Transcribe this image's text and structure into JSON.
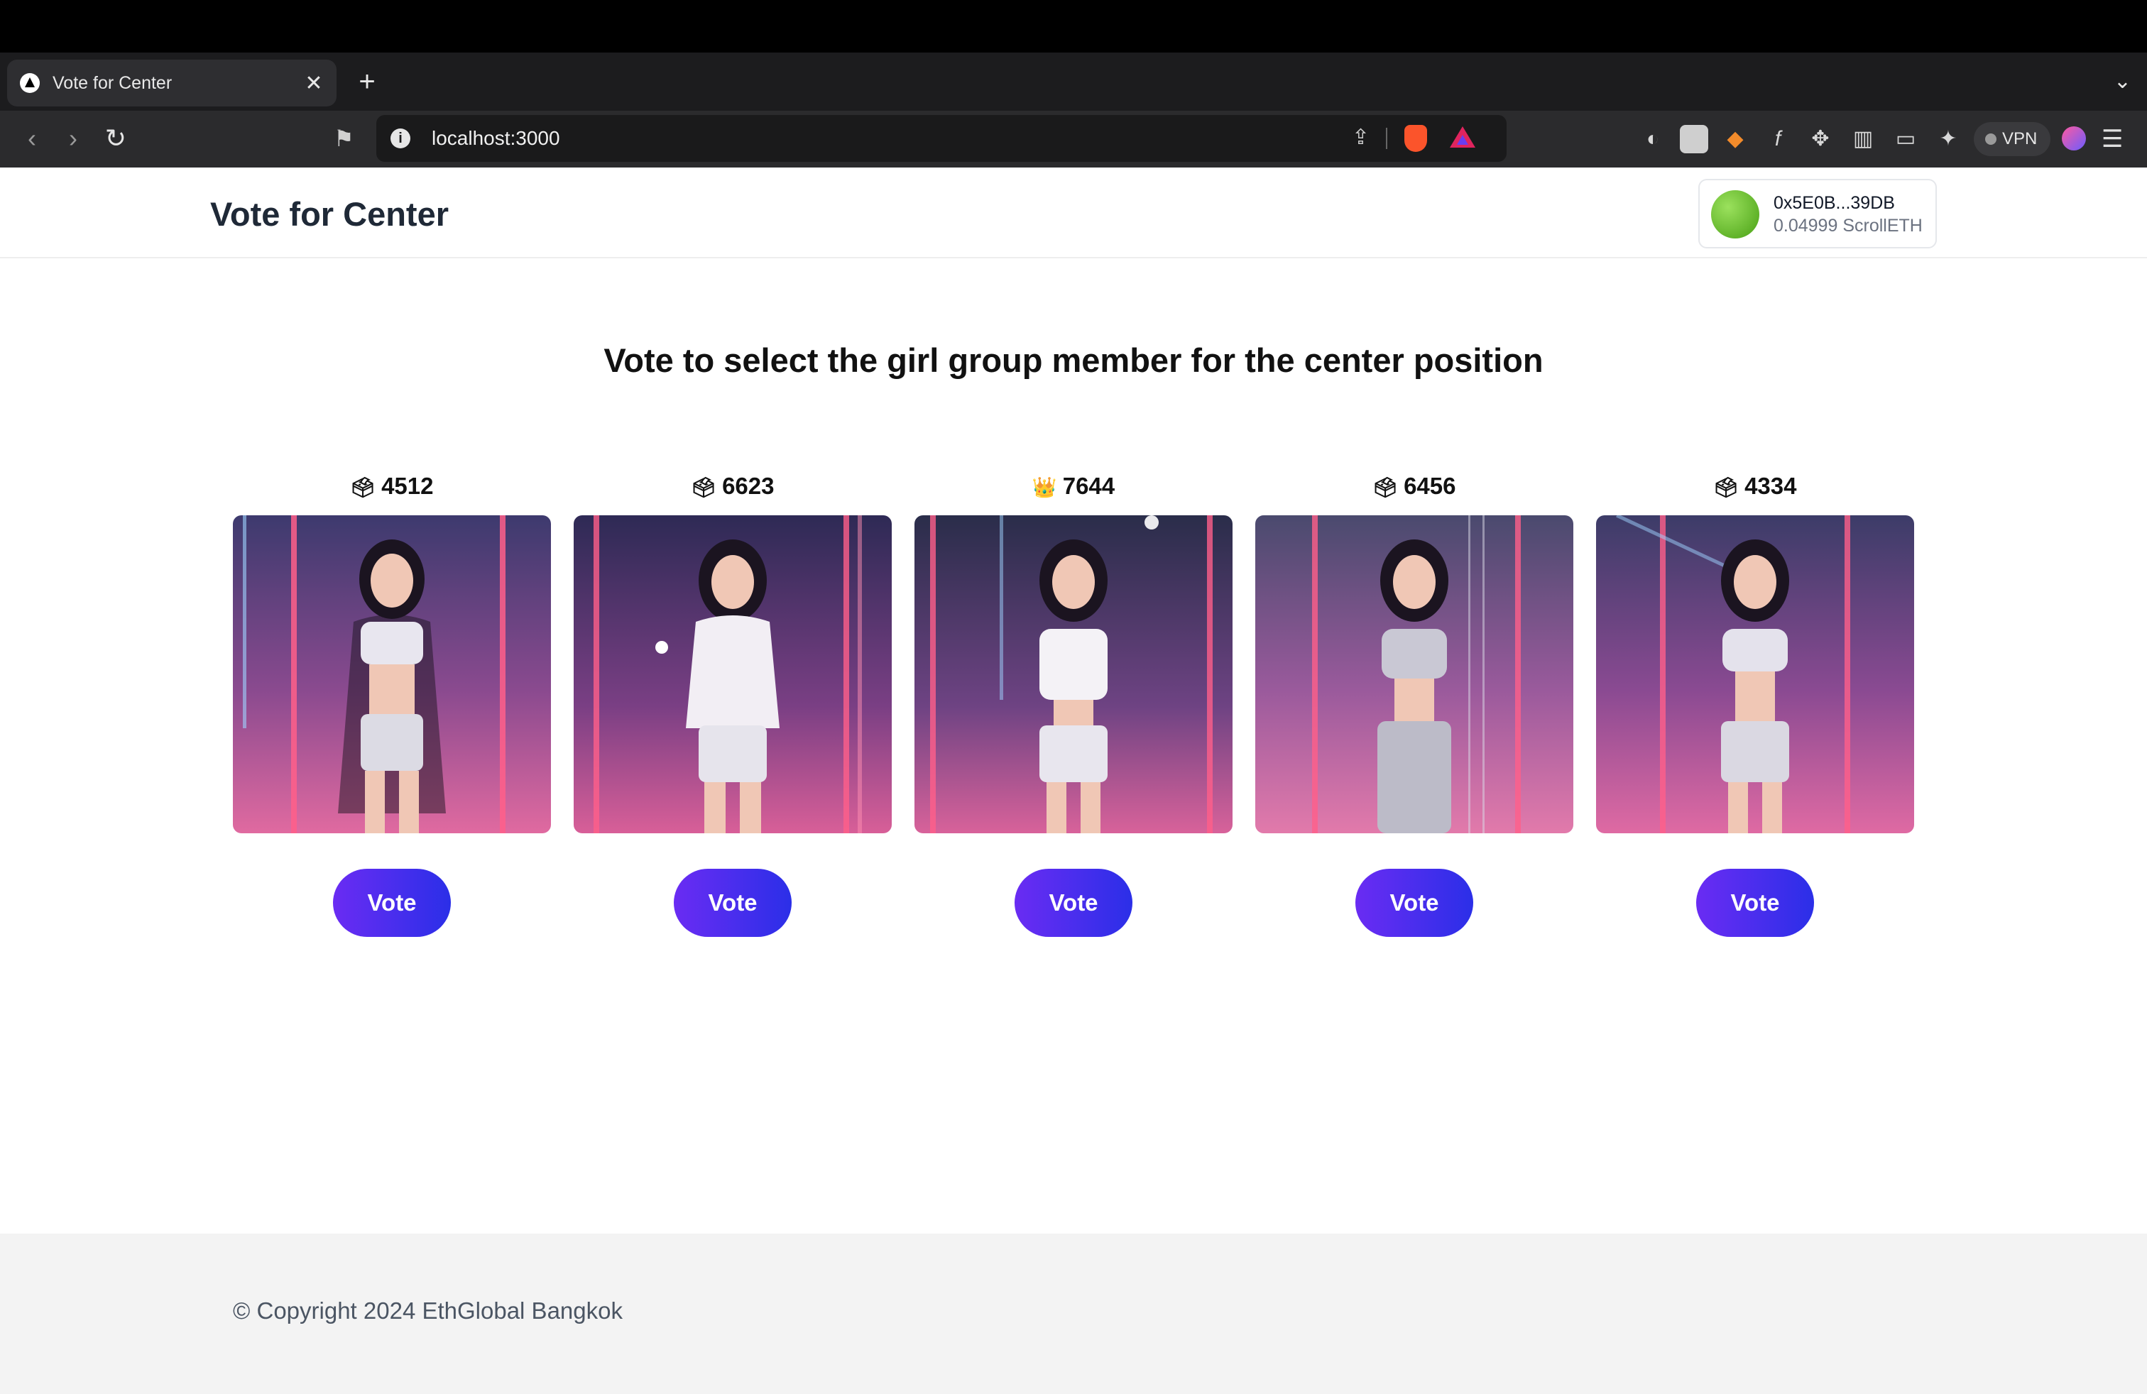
{
  "browser": {
    "tab_title": "Vote for Center",
    "tab_close": "✕",
    "new_tab": "+",
    "url": "localhost:3000",
    "vpn_label": "VPN"
  },
  "app": {
    "title": "Vote for Center",
    "wallet": {
      "address": "0x5E0B...39DB",
      "balance": "0.04999 ScrollETH"
    },
    "heading": "Vote to select the girl group member for the center position",
    "candidates": [
      {
        "icon": "ballot-box-icon",
        "icon_glyph": "🗳",
        "votes": "4512",
        "vote_label": "Vote"
      },
      {
        "icon": "ballot-box-icon",
        "icon_glyph": "🗳",
        "votes": "6623",
        "vote_label": "Vote"
      },
      {
        "icon": "crown-icon",
        "icon_glyph": "👑",
        "votes": "7644",
        "vote_label": "Vote"
      },
      {
        "icon": "ballot-box-icon",
        "icon_glyph": "🗳",
        "votes": "6456",
        "vote_label": "Vote"
      },
      {
        "icon": "ballot-box-icon",
        "icon_glyph": "🗳",
        "votes": "4334",
        "vote_label": "Vote"
      }
    ],
    "footer": "© Copyright 2024 EthGlobal Bangkok"
  },
  "colors": {
    "vote_button_start": "#6a2cf3",
    "vote_button_end": "#2b2fe8",
    "wallet_avatar": "#6cc21e"
  }
}
